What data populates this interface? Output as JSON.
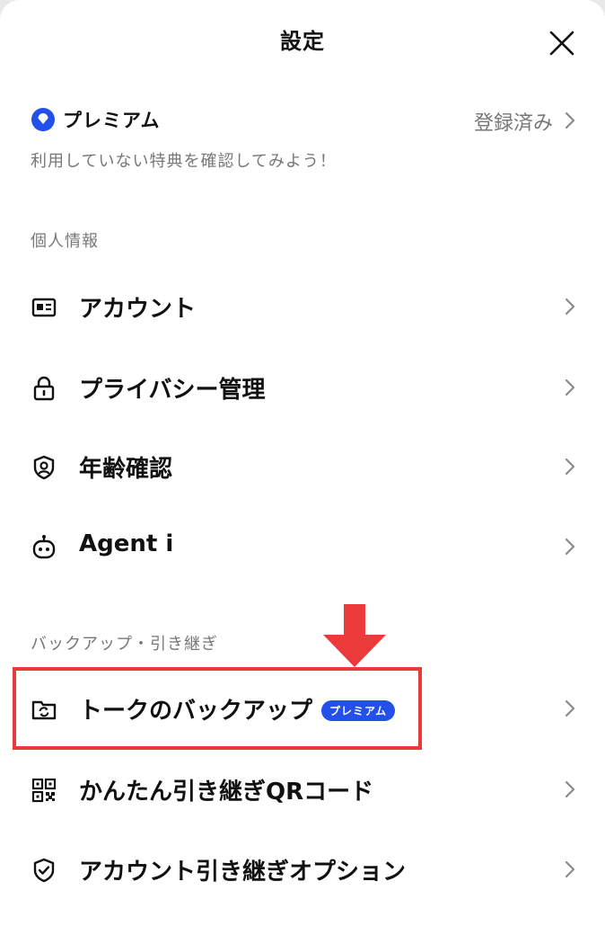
{
  "header": {
    "title": "設定"
  },
  "premium": {
    "logo_text": "プレミアム",
    "status": "登録済み",
    "subtitle": "利用していない特典を確認してみよう！"
  },
  "sections": [
    {
      "title": "個人情報",
      "items": [
        {
          "label": "アカウント",
          "icon": "id-card-icon"
        },
        {
          "label": "プライバシー管理",
          "icon": "lock-icon"
        },
        {
          "label": "年齢確認",
          "icon": "shield-person-icon"
        },
        {
          "label": "Agent i",
          "icon": "robot-icon"
        }
      ]
    },
    {
      "title": "バックアップ・引き継ぎ",
      "items": [
        {
          "label": "トークのバックアップ",
          "icon": "folder-sync-icon",
          "badge": "プレミアム",
          "highlighted": true
        },
        {
          "label": "かんたん引き継ぎQRコード",
          "icon": "qr-code-icon"
        },
        {
          "label": "アカウント引き継ぎオプション",
          "icon": "shield-check-icon"
        }
      ]
    }
  ],
  "colors": {
    "background": "#ffffff",
    "text": "#111111",
    "muted": "#777777",
    "premium_badge": "#2250e8",
    "annotation_red": "#ea3a3a"
  }
}
